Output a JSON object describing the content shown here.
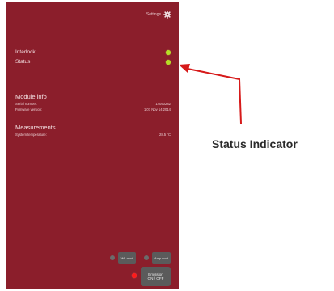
{
  "header": {
    "settings_label": "Settings",
    "icon": "gear-icon"
  },
  "status_rows": [
    {
      "label": "Interlock",
      "indicator_color": "#b6dd25"
    },
    {
      "label": "Status",
      "indicator_color": "#b6dd25"
    }
  ],
  "module_info": {
    "title": "Module info",
    "serial_label": "Serial number:",
    "serial_value": "14050282",
    "firmware_label": "Firmware version:",
    "firmware_value": "1.07 Nov 14 2014"
  },
  "measurements": {
    "title": "Measurements",
    "temp_label": "System temperature:",
    "temp_value": "28.5 °C"
  },
  "buttons": {
    "wl_mod": "WL mod",
    "amp_mod": "Amp mod",
    "emission_line1": "Emission",
    "emission_line2": "ON / OFF"
  },
  "annotation": {
    "text": "Status Indicator",
    "arrow_color": "#d61a1a"
  },
  "colors": {
    "panel_bg": "#8b1e2b",
    "led_green": "#b6dd25",
    "led_red": "#ff1a1a",
    "button_grey": "#5b5b5b"
  }
}
